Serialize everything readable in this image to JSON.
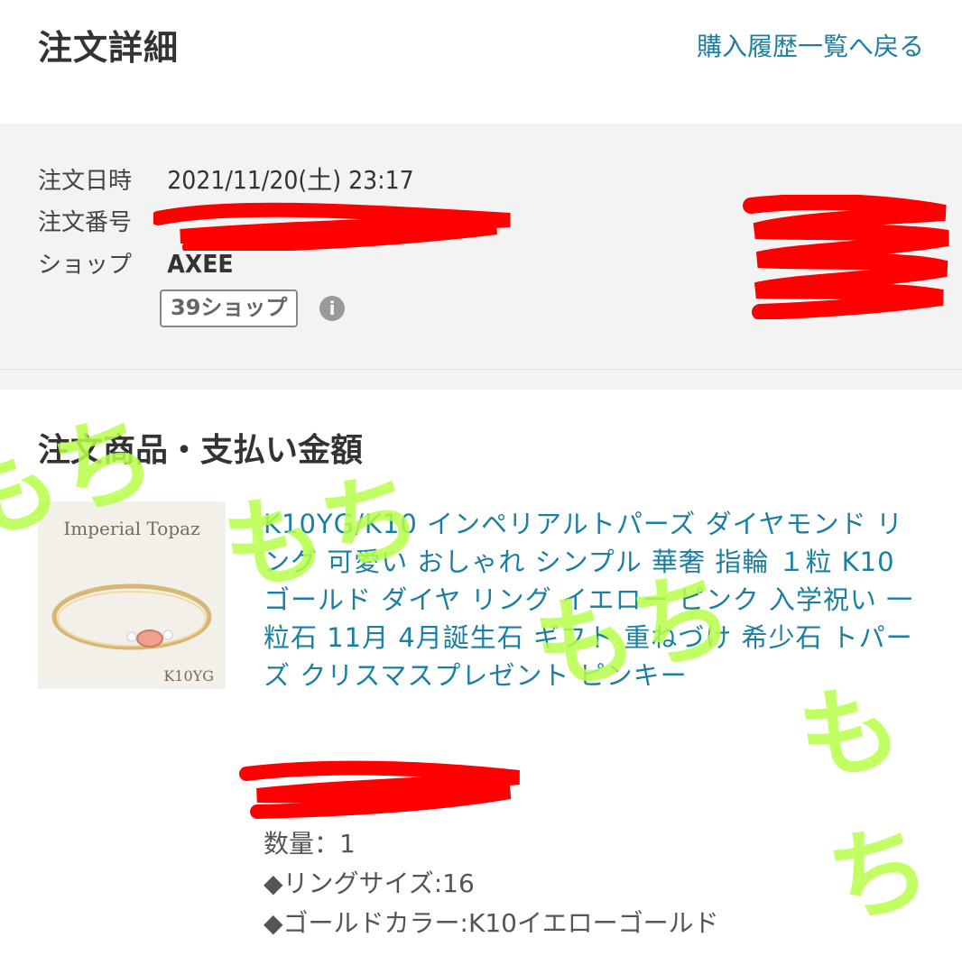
{
  "header": {
    "title": "注文詳細",
    "back_link": "購入履歴一覧へ戻る"
  },
  "order": {
    "date_label": "注文日時",
    "date_value": "2021/11/20(土)  23:17",
    "number_label": "注文番号",
    "number_value": "",
    "shop_label": "ショップ",
    "shop_value": "AXEE",
    "badge": "39ショップ",
    "info_icon": "i"
  },
  "items_section": {
    "title": "注文商品・支払い金額",
    "thumbnail": {
      "caption_top": "Imperial Topaz",
      "caption_bottom": "K10YG"
    },
    "product_name": "K10YG/K10 インペリアルトパーズ ダイヤモンド リング 可愛い おしゃれ シンプル 華奢 指輪 １粒 K10 ゴールド ダイヤ リング イエロー ピンク 入学祝い 一粒石 11月 4月誕生石 ギフト 重ねづけ 希少石 トパーズ クリスマスプレゼント ピンキー",
    "quantity": "数量：1",
    "option_ring_size": "◆リングサイズ:16",
    "option_gold_color": "◆ゴールドカラー:K10イエローゴールド"
  },
  "watermark": {
    "text": "もち"
  },
  "colors": {
    "link": "#1b7fa0",
    "panel_bg": "#f3f3f3",
    "redaction": "#ff0000",
    "watermark": "#b8ff4a"
  }
}
